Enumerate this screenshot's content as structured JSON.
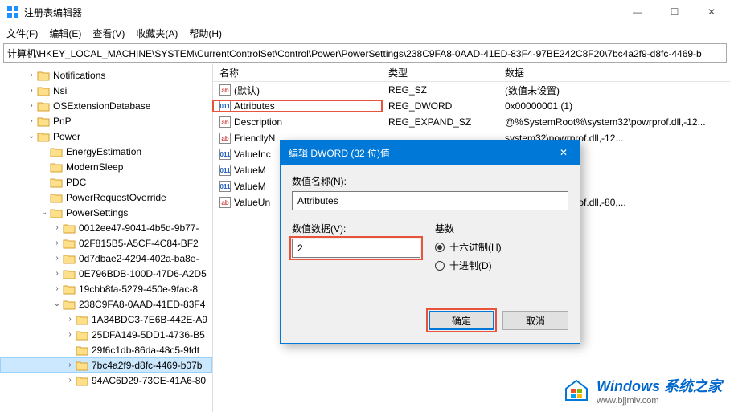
{
  "window": {
    "title": "注册表编辑器",
    "min": "—",
    "max": "☐",
    "close": "✕"
  },
  "menu": {
    "file": "文件(F)",
    "edit": "编辑(E)",
    "view": "查看(V)",
    "favorites": "收藏夹(A)",
    "help": "帮助(H)"
  },
  "address": "计算机\\HKEY_LOCAL_MACHINE\\SYSTEM\\CurrentControlSet\\Control\\Power\\PowerSettings\\238C9FA8-0AAD-41ED-83F4-97BE242C8F20\\7bc4a2f9-d8fc-4469-b",
  "tree": [
    {
      "indent": 2,
      "chev": ">",
      "label": "Notifications"
    },
    {
      "indent": 2,
      "chev": ">",
      "label": "Nsi"
    },
    {
      "indent": 2,
      "chev": ">",
      "label": "OSExtensionDatabase"
    },
    {
      "indent": 2,
      "chev": ">",
      "label": "PnP"
    },
    {
      "indent": 2,
      "chev": "v",
      "label": "Power"
    },
    {
      "indent": 3,
      "chev": "",
      "label": "EnergyEstimation"
    },
    {
      "indent": 3,
      "chev": "",
      "label": "ModernSleep"
    },
    {
      "indent": 3,
      "chev": "",
      "label": "PDC"
    },
    {
      "indent": 3,
      "chev": "",
      "label": "PowerRequestOverride"
    },
    {
      "indent": 3,
      "chev": "v",
      "label": "PowerSettings"
    },
    {
      "indent": 4,
      "chev": ">",
      "label": "0012ee47-9041-4b5d-9b77-"
    },
    {
      "indent": 4,
      "chev": ">",
      "label": "02F815B5-A5CF-4C84-BF2"
    },
    {
      "indent": 4,
      "chev": ">",
      "label": "0d7dbae2-4294-402a-ba8e-"
    },
    {
      "indent": 4,
      "chev": ">",
      "label": "0E796BDB-100D-47D6-A2D5"
    },
    {
      "indent": 4,
      "chev": ">",
      "label": "19cbb8fa-5279-450e-9fac-8"
    },
    {
      "indent": 4,
      "chev": "v",
      "label": "238C9FA8-0AAD-41ED-83F4"
    },
    {
      "indent": 5,
      "chev": ">",
      "label": "1A34BDC3-7E6B-442E-A9"
    },
    {
      "indent": 5,
      "chev": ">",
      "label": "25DFA149-5DD1-4736-B5"
    },
    {
      "indent": 5,
      "chev": "",
      "label": "29f6c1db-86da-48c5-9fdt"
    },
    {
      "indent": 5,
      "chev": ">",
      "label": "7bc4a2f9-d8fc-4469-b07b",
      "selected": true
    },
    {
      "indent": 5,
      "chev": ">",
      "label": "94AC6D29-73CE-41A6-80"
    }
  ],
  "columns": {
    "name": "名称",
    "type": "类型",
    "data": "数据"
  },
  "rows": [
    {
      "icon": "str",
      "name": "(默认)",
      "type": "REG_SZ",
      "data": "(数值未设置)"
    },
    {
      "icon": "bin",
      "name": "Attributes",
      "type": "REG_DWORD",
      "data": "0x00000001 (1)",
      "hl": true
    },
    {
      "icon": "str",
      "name": "Description",
      "type": "REG_EXPAND_SZ",
      "data": "@%SystemRoot%\\system32\\powrprof.dll,-12..."
    },
    {
      "icon": "str",
      "name": "FriendlyN",
      "type": "",
      "data": "                                                           system32\\powrprof.dll,-12..."
    },
    {
      "icon": "bin",
      "name": "ValueInc",
      "type": "",
      "data": ""
    },
    {
      "icon": "bin",
      "name": "ValueM",
      "type": "",
      "data": ""
    },
    {
      "icon": "bin",
      "name": "ValueM",
      "type": "",
      "data": ""
    },
    {
      "icon": "str",
      "name": "ValueUn",
      "type": "",
      "data": "                                                           system32\\powrprof.dll,-80,..."
    }
  ],
  "dialog": {
    "title": "编辑 DWORD (32 位)值",
    "close": "✕",
    "name_label": "数值名称(N):",
    "name_value": "Attributes",
    "data_label": "数值数据(V):",
    "data_value": "2",
    "base_label": "基数",
    "radio_hex": "十六进制(H)",
    "radio_dec": "十进制(D)",
    "ok": "确定",
    "cancel": "取消"
  },
  "watermark": {
    "main": "Windows 系统之家",
    "sub": "www.bjjmlv.com"
  }
}
